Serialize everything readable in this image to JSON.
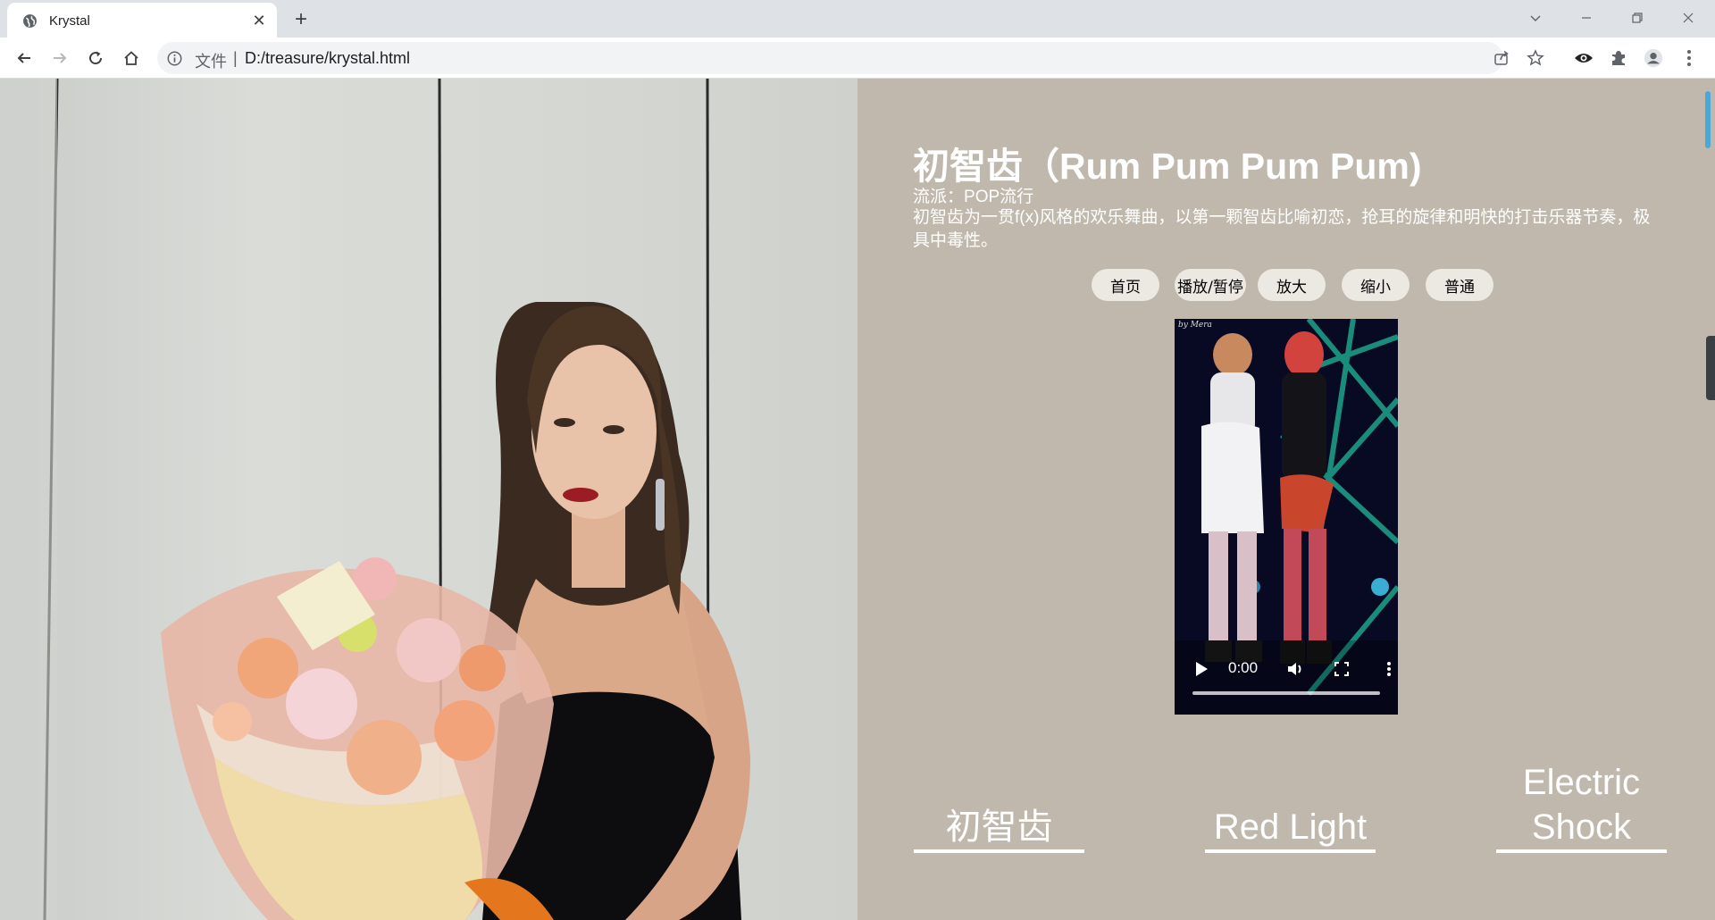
{
  "browser": {
    "tab_title": "Krystal",
    "url_label": "文件",
    "url_separator": "|",
    "url": "D:/treasure/krystal.html"
  },
  "song": {
    "title": "初智齿（Rum Pum Pum Pum)",
    "genre_label": "流派：",
    "genre": "POP流行",
    "description": "初智齿为一贯f(x)风格的欢乐舞曲，以第一颗智齿比喻初恋，抢耳的旋律和明快的打击乐器节奏，极具中毒性。"
  },
  "buttons": {
    "home": "首页",
    "play_pause": "播放/暂停",
    "zoom_in": "放大",
    "zoom_out": "缩小",
    "normal": "普通"
  },
  "video": {
    "credit": "by Mera",
    "time": "0:00"
  },
  "song_links": [
    "初智齿",
    "Red Light",
    "Electric Shock"
  ],
  "colors": {
    "page_background": "#c0b8ac",
    "button_background": "#ece8e2",
    "text": "#ffffff"
  }
}
